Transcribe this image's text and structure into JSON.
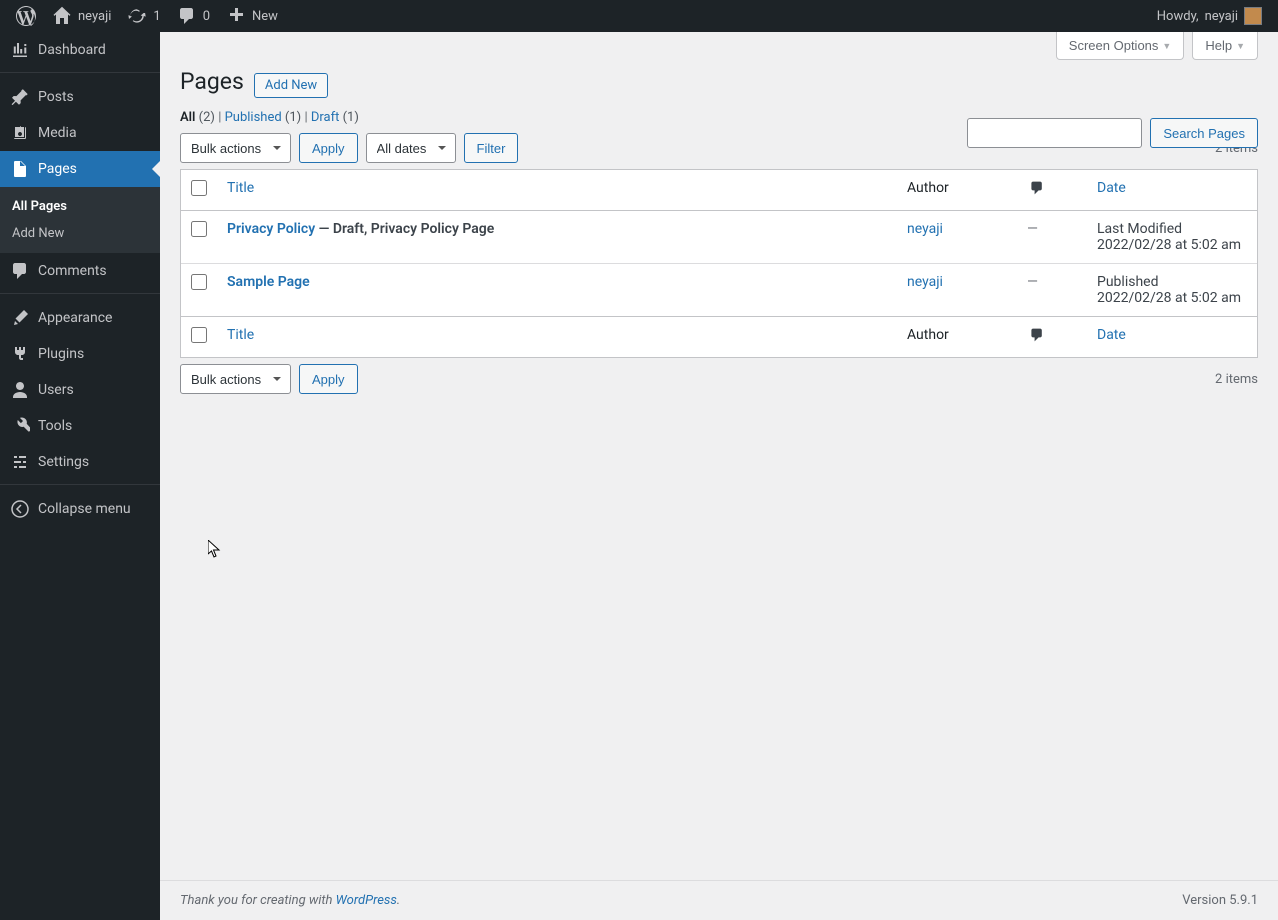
{
  "adminbar": {
    "site_name": "neyaji",
    "updates_count": "1",
    "comments_count": "0",
    "new_label": "New",
    "howdy_prefix": "Howdy, ",
    "user_name": "neyaji"
  },
  "sidebar": {
    "items": [
      {
        "id": "dashboard",
        "label": "Dashboard"
      },
      {
        "id": "posts",
        "label": "Posts"
      },
      {
        "id": "media",
        "label": "Media"
      },
      {
        "id": "pages",
        "label": "Pages"
      },
      {
        "id": "comments",
        "label": "Comments"
      },
      {
        "id": "appearance",
        "label": "Appearance"
      },
      {
        "id": "plugins",
        "label": "Plugins"
      },
      {
        "id": "users",
        "label": "Users"
      },
      {
        "id": "tools",
        "label": "Tools"
      },
      {
        "id": "settings",
        "label": "Settings"
      },
      {
        "id": "collapse",
        "label": "Collapse menu"
      }
    ],
    "submenu_pages": {
      "all_pages": "All Pages",
      "add_new": "Add New"
    }
  },
  "screen_meta": {
    "screen_options": "Screen Options",
    "help": "Help"
  },
  "heading": {
    "title": "Pages",
    "add_new": "Add New"
  },
  "subsubsub": {
    "all_label": "All",
    "all_count": "(2)",
    "published_label": "Published",
    "published_count": "(1)",
    "draft_label": "Draft",
    "draft_count": "(1)",
    "sep": " | "
  },
  "search": {
    "button": "Search Pages"
  },
  "tablenav": {
    "bulk_actions": "Bulk actions",
    "apply": "Apply",
    "all_dates": "All dates",
    "filter": "Filter",
    "items_count": "2 items"
  },
  "table": {
    "cols": {
      "title": "Title",
      "author": "Author",
      "date": "Date"
    },
    "rows": [
      {
        "title": "Privacy Policy",
        "state": " — Draft, Privacy Policy Page",
        "author": "neyaji",
        "comments": "—",
        "date_status": "Last Modified",
        "date_value": "2022/02/28 at 5:02 am"
      },
      {
        "title": "Sample Page",
        "state": "",
        "author": "neyaji",
        "comments": "—",
        "date_status": "Published",
        "date_value": "2022/02/28 at 5:02 am"
      }
    ]
  },
  "footer": {
    "thanks_prefix": "Thank you for creating with ",
    "wp_link": "WordPress",
    "thanks_suffix": ".",
    "version": "Version 5.9.1"
  }
}
